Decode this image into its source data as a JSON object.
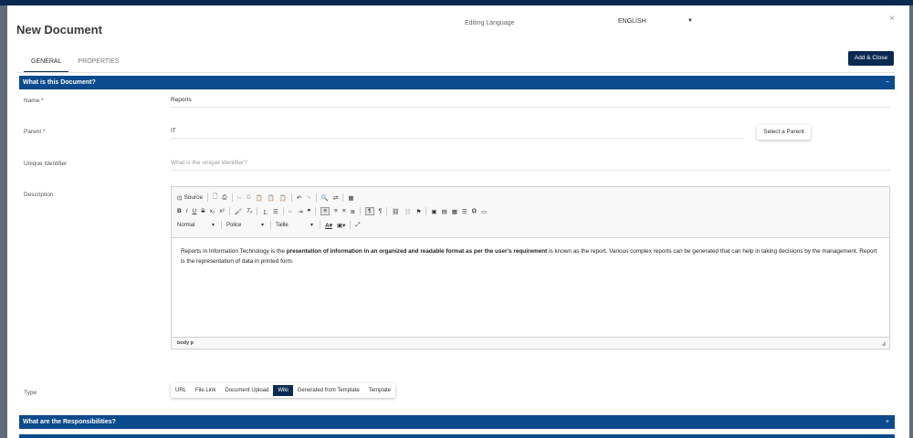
{
  "modal": {
    "title": "New Document",
    "editing_language_label": "Editing Language",
    "language_value": "ENGLISH",
    "close_symbol": "×"
  },
  "tabs": [
    {
      "label": "GENERAL",
      "active": true
    },
    {
      "label": "PROPERTIES",
      "active": false
    }
  ],
  "add_close_label": "Add & Close",
  "sections": [
    {
      "title": "What is this Document?",
      "toggle": "−"
    },
    {
      "title": "What are the Responsibilities?",
      "toggle": "+"
    }
  ],
  "fields": {
    "name": {
      "label": "Name *",
      "value": "Reports"
    },
    "parent": {
      "label": "Parent *",
      "value": "IT",
      "button": "Select a Parent"
    },
    "unique_id": {
      "label": "Unique Identifier",
      "placeholder": "What is the unique identifier?"
    },
    "description": {
      "label": "Description"
    },
    "type": {
      "label": "Type"
    }
  },
  "editor": {
    "source_label": "Source",
    "format_combo": "Normal",
    "font_combo": "Police",
    "size_combo": "Taille",
    "content_before": "Reports in Information Technology is the ",
    "content_bold": "presentation of information in an organized and readable format as per the user's requirement",
    "content_after": " is known as the report. Various complex reports can be generated that can help in taking decisions by the management. Report is the representation of data in printed form.",
    "status_path": "body  p"
  },
  "type_options": [
    {
      "label": "URL",
      "active": false
    },
    {
      "label": "File Link",
      "active": false
    },
    {
      "label": "Document Upload",
      "active": false
    },
    {
      "label": "Wiki",
      "active": true
    },
    {
      "label": "Generated from Template",
      "active": false
    },
    {
      "label": "Template",
      "active": false
    }
  ],
  "colors": {
    "section_bar": "#0b4a8c",
    "primary_dark": "#0b2a52",
    "backdrop": "#5e6b78"
  }
}
